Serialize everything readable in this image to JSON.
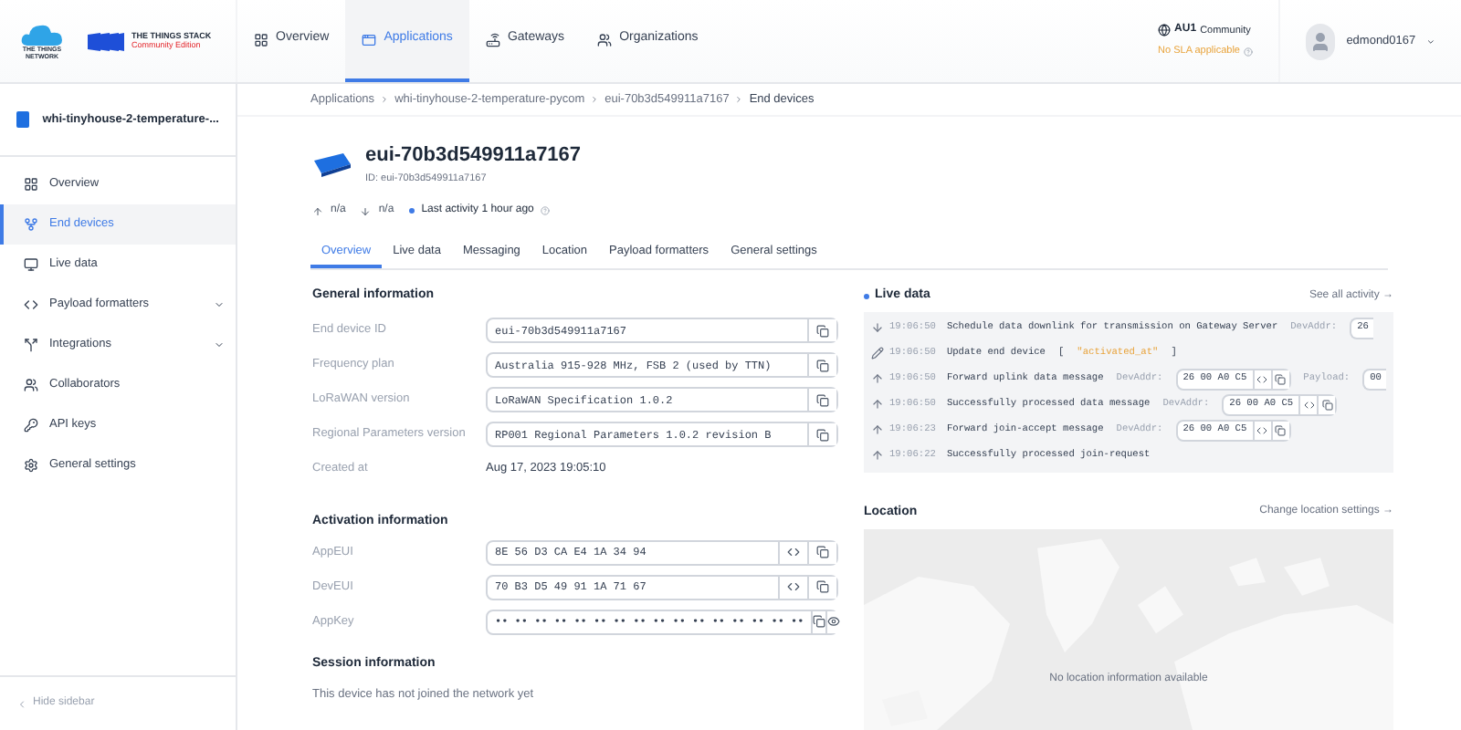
{
  "top_bar": {
    "network_logo": "THE THINGS NETWORK",
    "stack_logo": "THE THINGS STACK",
    "edition": "Community Edition",
    "nav": [
      {
        "label": "Overview",
        "selected": false
      },
      {
        "label": "Applications",
        "selected": true
      },
      {
        "label": "Gateways",
        "selected": false
      },
      {
        "label": "Organizations",
        "selected": false
      }
    ],
    "cluster": "AU1",
    "cluster_tier": "Community",
    "sla": "No SLA applicable",
    "user": "edmond0167"
  },
  "sidebar": {
    "app_name": "whi-tinyhouse-2-temperature-...",
    "items": [
      {
        "label": "Overview",
        "selected": false,
        "expandable": false
      },
      {
        "label": "End devices",
        "selected": true,
        "expandable": false
      },
      {
        "label": "Live data",
        "selected": false,
        "expandable": false
      },
      {
        "label": "Payload formatters",
        "selected": false,
        "expandable": true
      },
      {
        "label": "Integrations",
        "selected": false,
        "expandable": true
      },
      {
        "label": "Collaborators",
        "selected": false,
        "expandable": false
      },
      {
        "label": "API keys",
        "selected": false,
        "expandable": false
      },
      {
        "label": "General settings",
        "selected": false,
        "expandable": false
      }
    ],
    "hide_sidebar": "Hide sidebar"
  },
  "breadcrumbs": [
    "Applications",
    "whi-tinyhouse-2-temperature-pycom",
    "eui-70b3d549911a7167",
    "End devices"
  ],
  "device": {
    "title": "eui-70b3d549911a7167",
    "id_line": "ID: eui-70b3d549911a7167",
    "uplink": "n/a",
    "downlink": "n/a",
    "last_activity": "Last activity 1 hour ago"
  },
  "tabs": [
    {
      "label": "Overview",
      "selected": true
    },
    {
      "label": "Live data",
      "selected": false
    },
    {
      "label": "Messaging",
      "selected": false
    },
    {
      "label": "Location",
      "selected": false
    },
    {
      "label": "Payload formatters",
      "selected": false
    },
    {
      "label": "General settings",
      "selected": false
    }
  ],
  "general_information": {
    "heading": "General information",
    "fields": [
      {
        "label": "End device ID",
        "value": "eui-70b3d549911a7167",
        "kind": "copy"
      },
      {
        "label": "Frequency plan",
        "value": "Australia 915-928 MHz, FSB 2 (used by TTN)",
        "kind": "copy"
      },
      {
        "label": "LoRaWAN version",
        "value": "LoRaWAN Specification 1.0.2",
        "kind": "copy"
      },
      {
        "label": "Regional Parameters version",
        "value": "RP001 Regional Parameters 1.0.2 revision B",
        "kind": "copy"
      },
      {
        "label": "Created at",
        "value": "Aug 17, 2023 19:05:10",
        "kind": "text"
      }
    ]
  },
  "activation_information": {
    "heading": "Activation information",
    "fields": [
      {
        "label": "AppEUI",
        "value": "8E 56 D3 CA E4 1A 34 94",
        "kind": "eui"
      },
      {
        "label": "DevEUI",
        "value": "70 B3 D5 49 91 1A 71 67",
        "kind": "eui"
      },
      {
        "label": "AppKey",
        "value": "•• •• •• •• •• •• •• •• •• •• •• •• •• •• •• ••",
        "kind": "secret"
      }
    ]
  },
  "session_information": {
    "heading": "Session information",
    "text": "This device has not joined the network yet"
  },
  "live_data": {
    "title": "Live data",
    "link": "See all activity →",
    "events": [
      {
        "kind": "downlink",
        "time": "19:06:50",
        "message": "Schedule data downlink for transmission on Gateway Server",
        "extras": [
          {
            "kind": "label",
            "text": "DevAddr:"
          },
          {
            "kind": "field",
            "text": "26",
            "buttons": false
          }
        ]
      },
      {
        "kind": "update",
        "time": "19:06:50",
        "message": "Update end device",
        "extras": [
          {
            "kind": "text",
            "text": "["
          },
          {
            "kind": "code",
            "text": "\"activated_at\""
          },
          {
            "kind": "text",
            "text": "]"
          }
        ]
      },
      {
        "kind": "uplink",
        "time": "19:06:50",
        "message": "Forward uplink data message",
        "extras": [
          {
            "kind": "label",
            "text": "DevAddr:"
          },
          {
            "kind": "field",
            "text": "26 00 A0 C5",
            "buttons": true
          },
          {
            "kind": "label",
            "text": "Payload:"
          },
          {
            "kind": "field",
            "text": "00",
            "buttons": false
          }
        ]
      },
      {
        "kind": "uplink",
        "time": "19:06:50",
        "message": "Successfully processed data message",
        "extras": [
          {
            "kind": "label",
            "text": "DevAddr:"
          },
          {
            "kind": "field",
            "text": "26 00 A0 C5",
            "buttons": true
          }
        ]
      },
      {
        "kind": "uplink",
        "time": "19:06:23",
        "message": "Forward join-accept message",
        "extras": [
          {
            "kind": "label",
            "text": "DevAddr:"
          },
          {
            "kind": "field",
            "text": "26 00 A0 C5",
            "buttons": true
          }
        ]
      },
      {
        "kind": "uplink",
        "time": "19:06:22",
        "message": "Successfully processed join-request"
      }
    ]
  },
  "location": {
    "title": "Location",
    "link": "Change location settings →",
    "empty_text": "No location information available"
  }
}
